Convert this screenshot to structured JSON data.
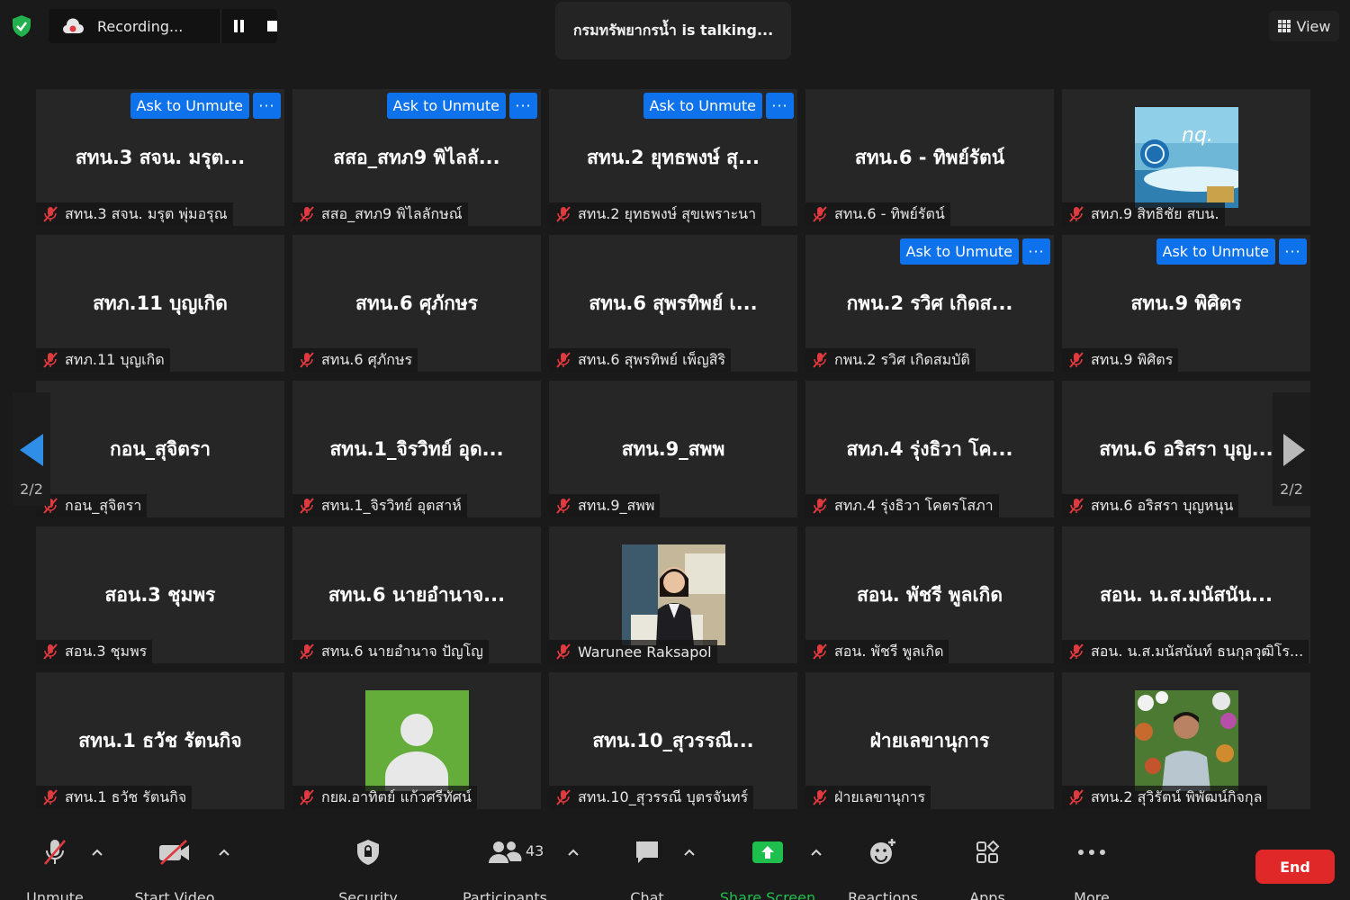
{
  "top": {
    "recording_text": "Recording...",
    "talking_text": "กรมทรัพยากรน้ำ is talking...",
    "view_label": "View"
  },
  "nav": {
    "page_indicator_left": "2/2",
    "page_indicator_right": "2/2"
  },
  "tiles": [
    {
      "name": "สทน.3 สจน. มรุต...",
      "label": "สทน.3 สจน. มรุต พุ่มอรุณ",
      "ask_unmute": true,
      "photo": null
    },
    {
      "name": "สสอ_สทภ9 พิไลลั...",
      "label": "สสอ_สทภ9 พิไลลักษณ์",
      "ask_unmute": true,
      "photo": null
    },
    {
      "name": "สทน.2 ยุทธพงษ์ สุ...",
      "label": "สทน.2 ยุทธพงษ์ สุขเพราะนา",
      "ask_unmute": true,
      "photo": null
    },
    {
      "name": "สทน.6 - ทิพย์รัตน์",
      "label": "สทน.6 - ทิพย์รัตน์",
      "ask_unmute": false,
      "photo": null
    },
    {
      "name": "",
      "label": "สทภ.9 สิทธิชัย สบน.",
      "ask_unmute": false,
      "photo": "logo"
    },
    {
      "name": "สทภ.11 บุญเกิด",
      "label": "สทภ.11 บุญเกิด",
      "ask_unmute": false,
      "photo": null
    },
    {
      "name": "สทน.6 ศุภักษร",
      "label": "สทน.6 ศุภักษร",
      "ask_unmute": false,
      "photo": null
    },
    {
      "name": "สทน.6 สุพรทิพย์ เ...",
      "label": "สทน.6 สุพรทิพย์ เพ็ญสิริ",
      "ask_unmute": false,
      "photo": null
    },
    {
      "name": "กพน.2 รวิศ เกิดส...",
      "label": "กพน.2 รวิศ เกิดสมบัติ",
      "ask_unmute": true,
      "photo": null
    },
    {
      "name": "สทน.9 พิศิตร",
      "label": "สทน.9 พิศิตร",
      "ask_unmute": true,
      "photo": null
    },
    {
      "name": "กอน_สุจิตรา",
      "label": "กอน_สุจิตรา",
      "ask_unmute": false,
      "photo": null
    },
    {
      "name": "สทน.1_จิรวิทย์ อุด...",
      "label": "สทน.1_จิรวิทย์ อุตสาห์",
      "ask_unmute": false,
      "photo": null
    },
    {
      "name": "สทน.9_สพพ",
      "label": "สทน.9_สพพ",
      "ask_unmute": false,
      "photo": null
    },
    {
      "name": "สทภ.4 รุ่งธิวา โค...",
      "label": "สทภ.4 รุ่งธิวา โคตรโสภา",
      "ask_unmute": false,
      "photo": null
    },
    {
      "name": "สทน.6 อริสรา บุญ...",
      "label": "สทน.6 อริสรา บุญหนุน",
      "ask_unmute": false,
      "photo": null
    },
    {
      "name": "สอน.3 ชุมพร",
      "label": "สอน.3 ชุมพร",
      "ask_unmute": false,
      "photo": null
    },
    {
      "name": "สทน.6 นายอำนาจ...",
      "label": "สทน.6 นายอำนาจ ปัญโญ",
      "ask_unmute": false,
      "photo": null
    },
    {
      "name": "",
      "label": "Warunee Raksapol",
      "ask_unmute": false,
      "photo": "woman"
    },
    {
      "name": "สอน. พัชรี พูลเกิด",
      "label": "สอน. พัชรี พูลเกิด",
      "ask_unmute": false,
      "photo": null
    },
    {
      "name": "สอน. น.ส.มนัสนัน...",
      "label": "สอน. น.ส.มนัสนันท์ ธนกุลวุฒิโร...",
      "ask_unmute": false,
      "photo": null
    },
    {
      "name": "สทน.1 ธวัช รัตนกิจ",
      "label": "สทน.1 ธวัช รัตนกิจ",
      "ask_unmute": false,
      "photo": null
    },
    {
      "name": "",
      "label": "กยผ.อาทิตย์ แก้วศรีทัศน์",
      "ask_unmute": false,
      "photo": "avatar"
    },
    {
      "name": "สทน.10_สุวรรณี...",
      "label": "สทน.10_สุวรรณี บุตรจันทร์",
      "ask_unmute": false,
      "photo": null
    },
    {
      "name": "ฝ่ายเลขานุการ",
      "label": "ฝ่ายเลขานุการ",
      "ask_unmute": false,
      "photo": null
    },
    {
      "name": "",
      "label": "สทน.2 สุวิรัตน์ พิพัฒน์กิจกุล",
      "ask_unmute": false,
      "photo": "man"
    }
  ],
  "tile_buttons": {
    "ask_unmute": "Ask to Unmute",
    "more": "···"
  },
  "toolbar": {
    "unmute": "Unmute",
    "start_video": "Start Video",
    "security": "Security",
    "participants": "Participants",
    "participants_count": "43",
    "chat": "Chat",
    "share_screen": "Share Screen",
    "reactions": "Reactions",
    "apps": "Apps",
    "more": "More",
    "end": "End"
  },
  "colors": {
    "accent": "#0e72ed",
    "end": "#e02828",
    "share": "#1fbf4e",
    "muted": "#e0393e"
  }
}
